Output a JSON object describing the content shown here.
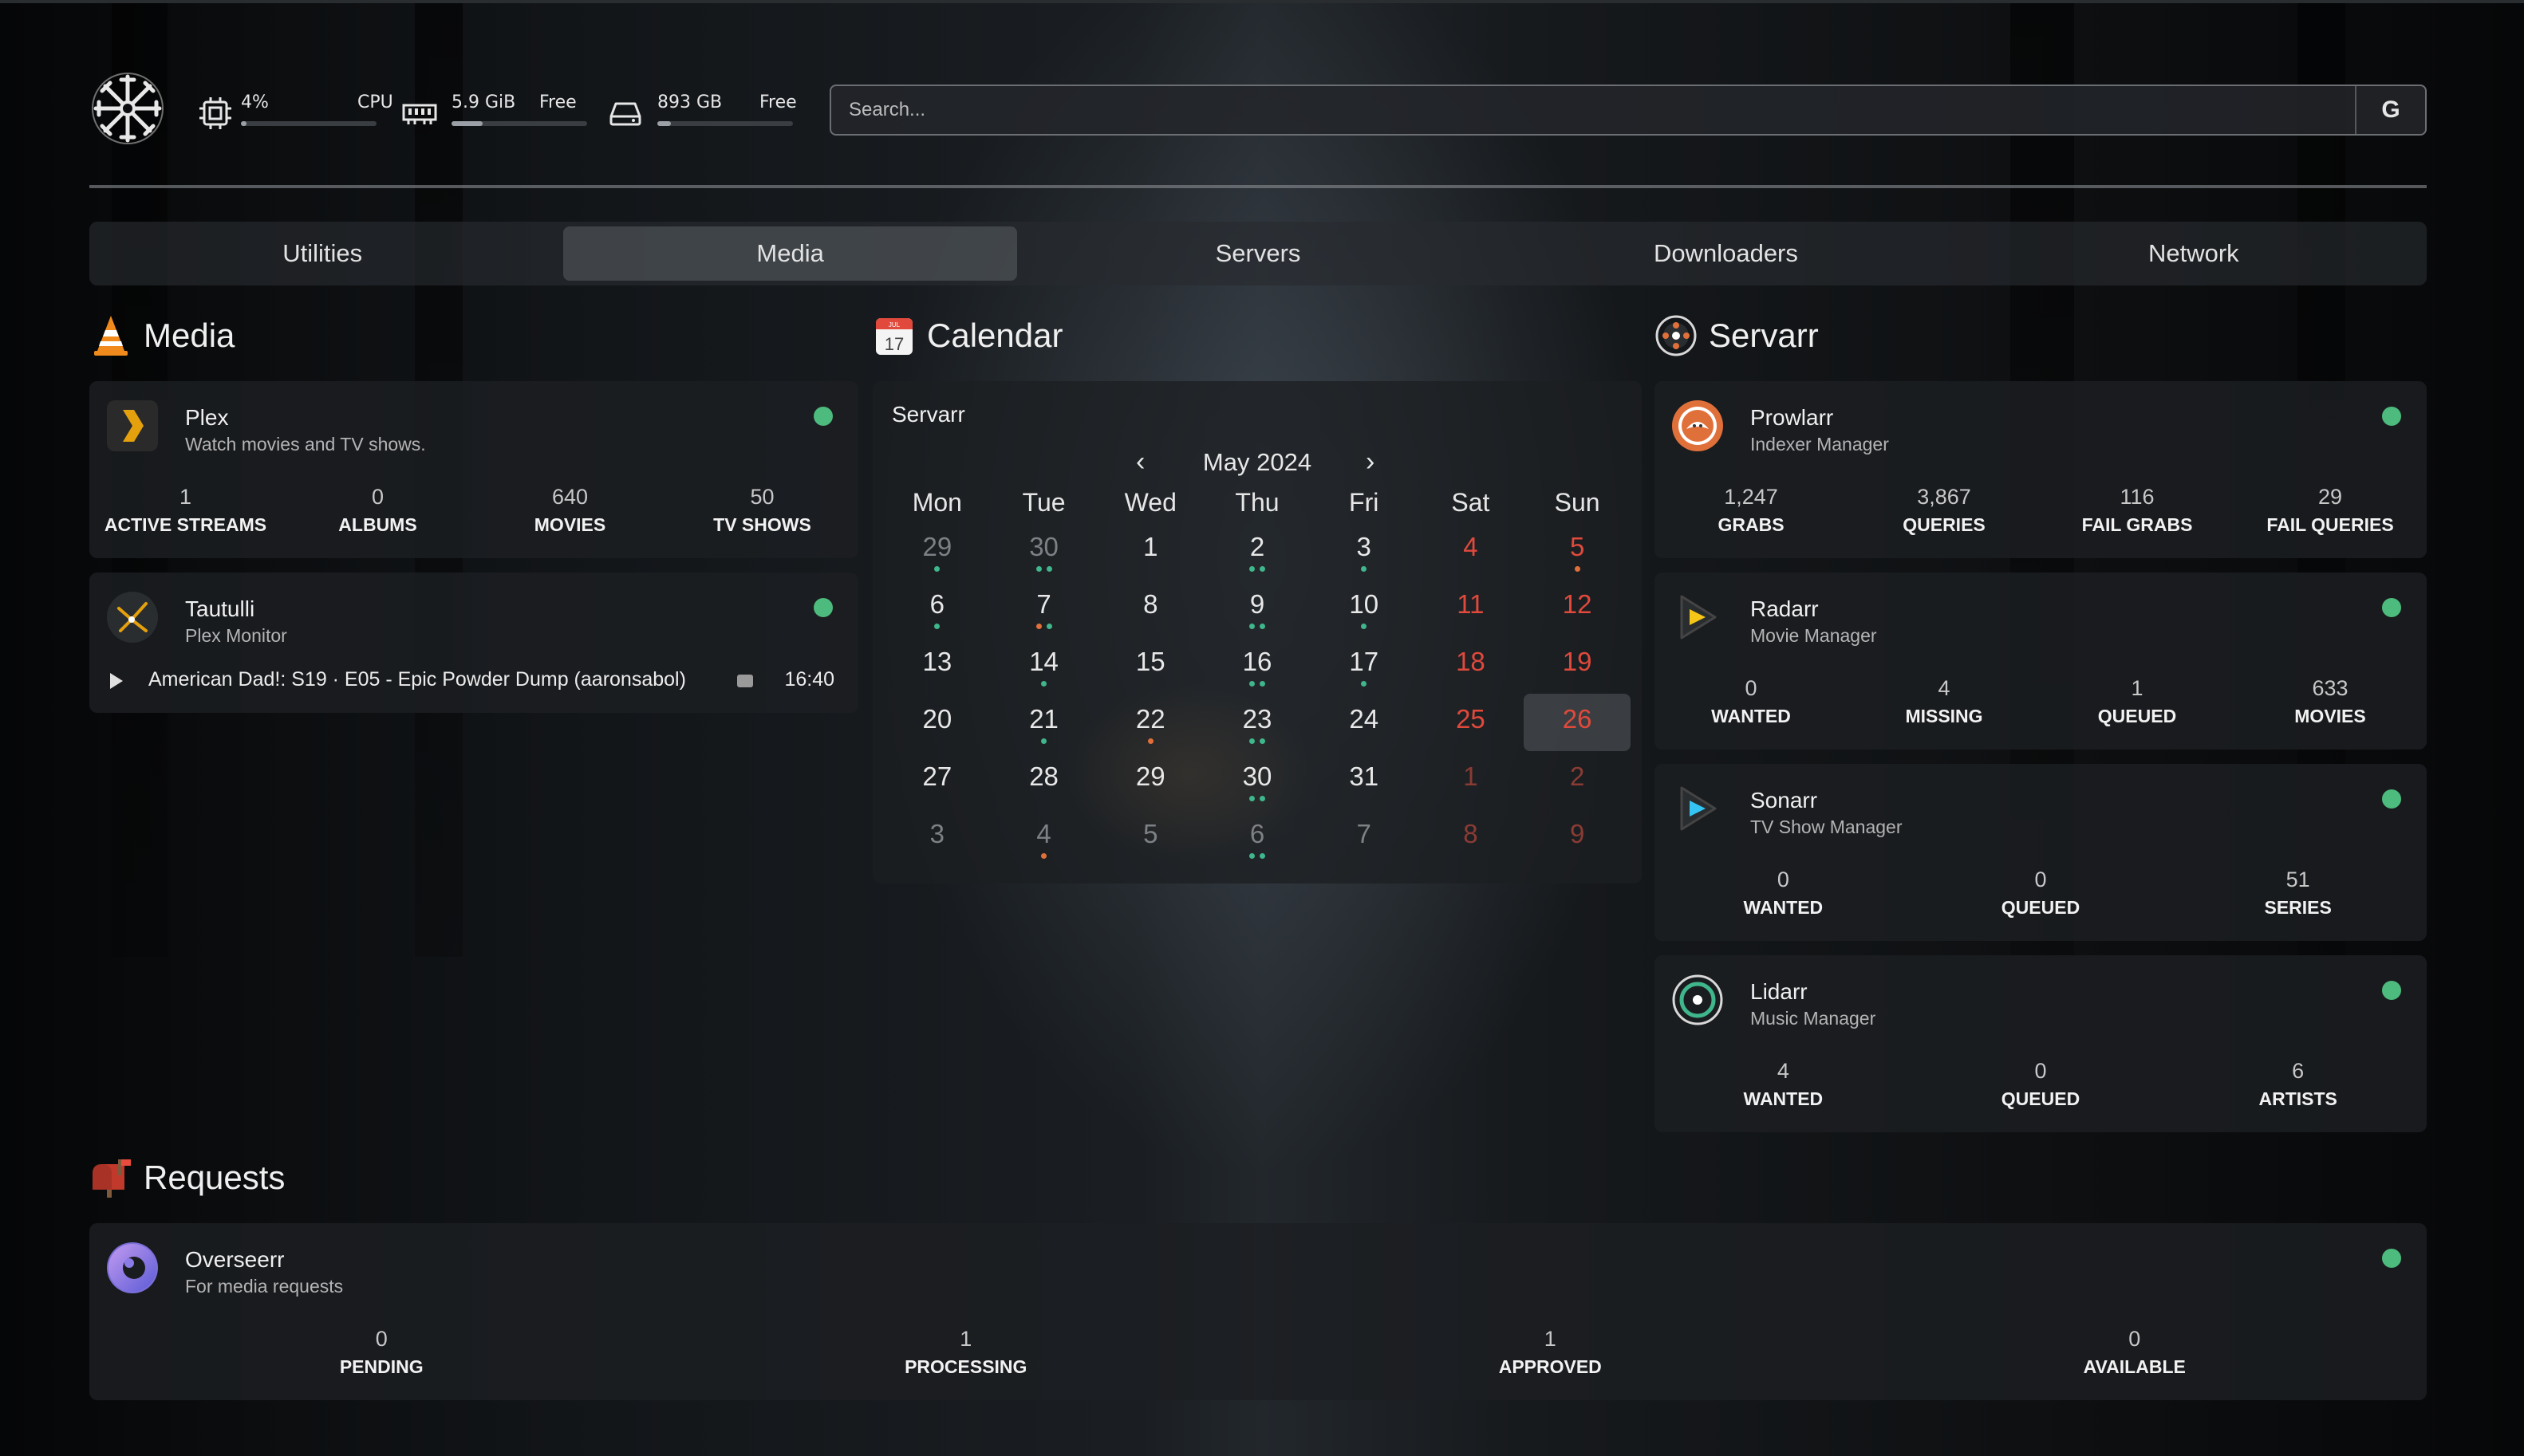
{
  "header": {
    "stats": {
      "cpu": {
        "value": "4%",
        "label": "CPU",
        "fraction": 0.04
      },
      "ram": {
        "value": "5.9 GiB",
        "label": "Free",
        "fraction": 0.23
      },
      "disk": {
        "value": "893 GB",
        "label": "Free",
        "fraction": 0.1
      }
    },
    "search": {
      "placeholder": "Search...",
      "engine_label": "G"
    }
  },
  "tabs": [
    "Utilities",
    "Media",
    "Servers",
    "Downloaders",
    "Network"
  ],
  "active_tab": "Media",
  "media": {
    "title": "Media",
    "plex": {
      "name": "Plex",
      "desc": "Watch movies and TV shows.",
      "stats": [
        {
          "n": "1",
          "l": "ACTIVE STREAMS"
        },
        {
          "n": "0",
          "l": "ALBUMS"
        },
        {
          "n": "640",
          "l": "MOVIES"
        },
        {
          "n": "50",
          "l": "TV SHOWS"
        }
      ]
    },
    "tautulli": {
      "name": "Tautulli",
      "desc": "Plex Monitor",
      "now_playing": "American Dad!: S19 · E05 - Epic Powder Dump (aaronsabol)",
      "time": "16:40"
    }
  },
  "calendar": {
    "title": "Calendar",
    "icon_month": "JUL",
    "icon_day": "17",
    "card_title": "Servarr",
    "month": "May 2024",
    "prev": "‹",
    "next": "›",
    "weekdays": [
      "Mon",
      "Tue",
      "Wed",
      "Thu",
      "Fri",
      "Sat",
      "Sun"
    ],
    "days": [
      {
        "d": "29",
        "m": true,
        "dots": [
          "g"
        ]
      },
      {
        "d": "30",
        "m": true,
        "dots": [
          "g",
          "g"
        ]
      },
      {
        "d": "1",
        "dots": []
      },
      {
        "d": "2",
        "dots": [
          "g",
          "g"
        ]
      },
      {
        "d": "3",
        "dots": [
          "g"
        ]
      },
      {
        "d": "4",
        "we": true,
        "dots": []
      },
      {
        "d": "5",
        "we": true,
        "dots": [
          "o"
        ]
      },
      {
        "d": "6",
        "dots": [
          "g"
        ]
      },
      {
        "d": "7",
        "dots": [
          "o",
          "g"
        ]
      },
      {
        "d": "8",
        "dots": []
      },
      {
        "d": "9",
        "dots": [
          "g",
          "g"
        ]
      },
      {
        "d": "10",
        "dots": [
          "g"
        ]
      },
      {
        "d": "11",
        "we": true,
        "dots": []
      },
      {
        "d": "12",
        "we": true,
        "dots": []
      },
      {
        "d": "13",
        "dots": []
      },
      {
        "d": "14",
        "dots": [
          "g"
        ]
      },
      {
        "d": "15",
        "dots": []
      },
      {
        "d": "16",
        "dots": [
          "g",
          "g"
        ]
      },
      {
        "d": "17",
        "dots": [
          "g"
        ]
      },
      {
        "d": "18",
        "we": true,
        "dots": []
      },
      {
        "d": "19",
        "we": true,
        "dots": []
      },
      {
        "d": "20",
        "dots": []
      },
      {
        "d": "21",
        "dots": [
          "g"
        ]
      },
      {
        "d": "22",
        "dots": [
          "o"
        ]
      },
      {
        "d": "23",
        "dots": [
          "g",
          "g"
        ]
      },
      {
        "d": "24",
        "dots": []
      },
      {
        "d": "25",
        "we": true,
        "dots": []
      },
      {
        "d": "26",
        "we": true,
        "today": true,
        "dots": []
      },
      {
        "d": "27",
        "dots": []
      },
      {
        "d": "28",
        "dots": []
      },
      {
        "d": "29",
        "dots": []
      },
      {
        "d": "30",
        "dots": [
          "g",
          "g"
        ]
      },
      {
        "d": "31",
        "dots": []
      },
      {
        "d": "1",
        "we": true,
        "m": true,
        "dots": []
      },
      {
        "d": "2",
        "we": true,
        "m": true,
        "dots": []
      },
      {
        "d": "3",
        "m": true,
        "dots": []
      },
      {
        "d": "4",
        "m": true,
        "dots": [
          "o"
        ]
      },
      {
        "d": "5",
        "m": true,
        "dots": []
      },
      {
        "d": "6",
        "m": true,
        "dots": [
          "g",
          "g"
        ]
      },
      {
        "d": "7",
        "m": true,
        "dots": []
      },
      {
        "d": "8",
        "we": true,
        "m": true,
        "dots": []
      },
      {
        "d": "9",
        "we": true,
        "m": true,
        "dots": []
      }
    ]
  },
  "servarr": {
    "title": "Servarr",
    "prowlarr": {
      "name": "Prowlarr",
      "desc": "Indexer Manager",
      "stats": [
        {
          "n": "1,247",
          "l": "GRABS"
        },
        {
          "n": "3,867",
          "l": "QUERIES"
        },
        {
          "n": "116",
          "l": "FAIL GRABS"
        },
        {
          "n": "29",
          "l": "FAIL QUERIES"
        }
      ]
    },
    "radarr": {
      "name": "Radarr",
      "desc": "Movie Manager",
      "stats": [
        {
          "n": "0",
          "l": "WANTED"
        },
        {
          "n": "4",
          "l": "MISSING"
        },
        {
          "n": "1",
          "l": "QUEUED"
        },
        {
          "n": "633",
          "l": "MOVIES"
        }
      ]
    },
    "sonarr": {
      "name": "Sonarr",
      "desc": "TV Show Manager",
      "stats": [
        {
          "n": "0",
          "l": "WANTED"
        },
        {
          "n": "0",
          "l": "QUEUED"
        },
        {
          "n": "51",
          "l": "SERIES"
        }
      ]
    },
    "lidarr": {
      "name": "Lidarr",
      "desc": "Music Manager",
      "stats": [
        {
          "n": "4",
          "l": "WANTED"
        },
        {
          "n": "0",
          "l": "QUEUED"
        },
        {
          "n": "6",
          "l": "ARTISTS"
        }
      ]
    }
  },
  "requests": {
    "title": "Requests",
    "overseerr": {
      "name": "Overseerr",
      "desc": "For media requests",
      "stats": [
        {
          "n": "0",
          "l": "PENDING"
        },
        {
          "n": "1",
          "l": "PROCESSING"
        },
        {
          "n": "1",
          "l": "APPROVED"
        },
        {
          "n": "0",
          "l": "AVAILABLE"
        }
      ]
    }
  },
  "colors": {
    "status_online": "#4dbb7d",
    "weekend": "#e0493c",
    "dot_green": "#3fb68b",
    "dot_orange": "#e0703a"
  },
  "icons": {
    "logo": "vegvisir-icon",
    "cpu": "cpu-icon",
    "ram": "memory-icon",
    "disk": "disk-icon"
  }
}
